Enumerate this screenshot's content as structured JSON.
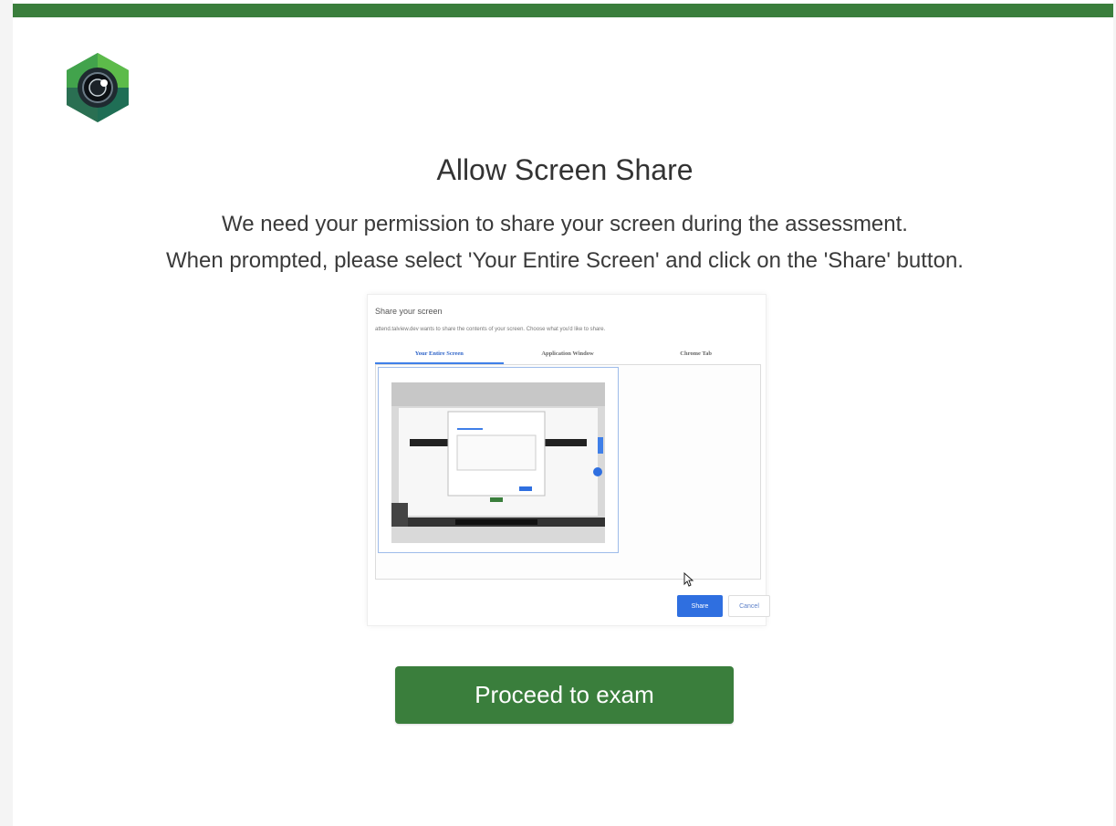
{
  "colors": {
    "brand_green": "#3a7e3c",
    "share_blue": "#2f6fe0",
    "tab_blue": "#3f7fe8"
  },
  "logo": {
    "icon": "camera-lens-icon"
  },
  "heading": {
    "title": "Allow Screen Share",
    "line1": "We need your permission to share your screen during the assessment.",
    "line2": "When prompted, please select 'Your Entire Screen' and click on the 'Share' button."
  },
  "illustration": {
    "dialog_title": "Share your screen",
    "dialog_description": "attend.talview.dev wants to share the contents of your screen. Choose what you'd like to share.",
    "tabs": [
      {
        "label": "Your Entire Screen",
        "active": true
      },
      {
        "label": "Application Window",
        "active": false
      },
      {
        "label": "Chrome Tab",
        "active": false
      }
    ],
    "share_label": "Share",
    "cancel_label": "Cancel"
  },
  "actions": {
    "proceed_label": "Proceed to exam"
  }
}
